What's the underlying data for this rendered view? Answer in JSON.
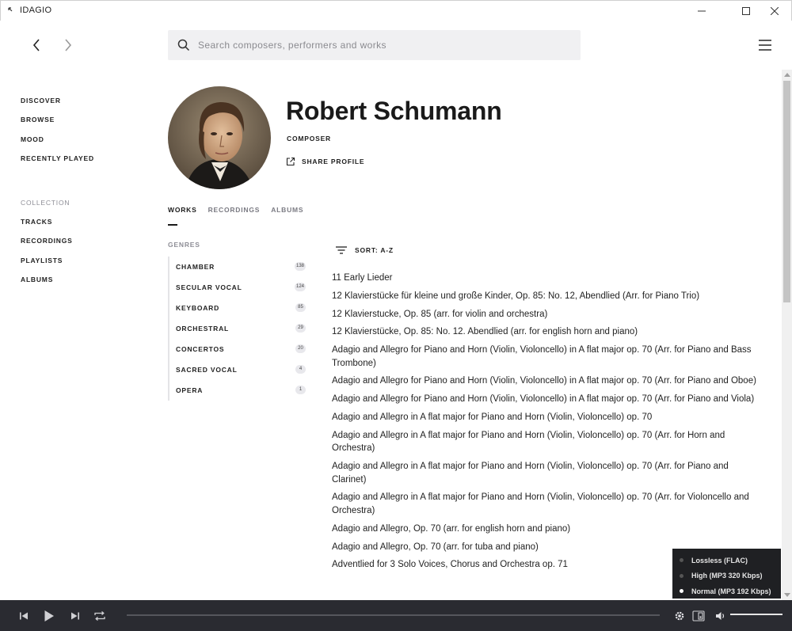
{
  "window": {
    "title": "IDAGIO"
  },
  "search": {
    "placeholder": "Search composers, performers and works"
  },
  "sidebar": {
    "items": [
      "DISCOVER",
      "BROWSE",
      "MOOD",
      "RECENTLY PLAYED"
    ],
    "collection_heading": "COLLECTION",
    "collection_items": [
      "TRACKS",
      "RECORDINGS",
      "PLAYLISTS",
      "ALBUMS"
    ]
  },
  "profile": {
    "name": "Robert Schumann",
    "role": "COMPOSER",
    "share_label": "SHARE PROFILE"
  },
  "tabs": {
    "items": [
      "WORKS",
      "RECORDINGS",
      "ALBUMS"
    ],
    "active": "WORKS"
  },
  "genres": {
    "heading": "GENRES",
    "items": [
      {
        "name": "CHAMBER",
        "count": "138"
      },
      {
        "name": "SECULAR VOCAL",
        "count": "124"
      },
      {
        "name": "KEYBOARD",
        "count": "85"
      },
      {
        "name": "ORCHESTRAL",
        "count": "29"
      },
      {
        "name": "CONCERTOS",
        "count": "20"
      },
      {
        "name": "SACRED VOCAL",
        "count": "4"
      },
      {
        "name": "OPERA",
        "count": "1"
      }
    ]
  },
  "sort": {
    "label": "SORT: A-Z"
  },
  "works": [
    "11 Early Lieder",
    "12 Klavierstücke für kleine und große Kinder, Op. 85: No. 12, Abendlied (Arr. for Piano Trio)",
    "12 Klavierstucke, Op. 85 (arr. for violin and orchestra)",
    "12 Klavierstücke, Op. 85: No. 12. Abendlied (arr. for english horn and piano)",
    "Adagio and Allegro for Piano and Horn (Violin, Violoncello) in A flat major op. 70 (Arr. for Piano and Bass Trombone)",
    "Adagio and Allegro for Piano and Horn (Violin, Violoncello) in A flat major op. 70 (Arr. for Piano and Oboe)",
    "Adagio and Allegro for Piano and Horn (Violin, Violoncello) in A flat major op. 70 (Arr. for Piano and Viola)",
    "Adagio and Allegro in A flat major for Piano and Horn (Violin, Violoncello) op. 70",
    "Adagio and Allegro in A flat major for Piano and Horn (Violin, Violoncello) op. 70 (Arr. for Horn and Orchestra)",
    "Adagio and Allegro in A flat major for Piano and Horn (Violin, Violoncello) op. 70 (Arr. for Piano and Clarinet)",
    "Adagio and Allegro in A flat major for Piano and Horn (Violin, Violoncello) op. 70 (Arr. for Violoncello and Orchestra)",
    "Adagio and Allegro, Op. 70 (arr. for english horn and piano)",
    "Adagio and Allegro, Op. 70 (arr. for tuba and piano)",
    "Adventlied for 3 Solo Voices, Chorus and Orchestra op. 71"
  ],
  "quality": {
    "options": [
      "Lossless (FLAC)",
      "High (MP3 320 Kbps)",
      "Normal (MP3 192 Kbps)"
    ],
    "selected": "Normal (MP3 192 Kbps)"
  },
  "player": {
    "progress_fraction": 0,
    "volume_fraction": 1
  },
  "icons": {
    "back": "chevron-left-icon",
    "forward": "chevron-right-icon",
    "search": "search-icon",
    "menu": "hamburger-menu-icon",
    "share": "external-link-icon",
    "sort": "sort-lines-icon",
    "previous": "skip-previous-icon",
    "play": "play-icon",
    "next": "skip-next-icon",
    "repeat": "repeat-icon",
    "settings": "gear-icon",
    "device": "speaker-device-icon",
    "volume": "volume-icon"
  },
  "colors": {
    "player_bg": "#2a2b31",
    "popup_bg": "#1f2023",
    "search_bg": "#f0f0f2",
    "text": "#1e1e1e",
    "muted": "#8e8e96"
  }
}
